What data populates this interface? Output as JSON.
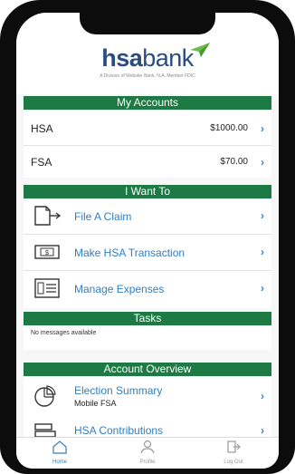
{
  "brand": {
    "logo_text_a": "hsa",
    "logo_text_b": "bank",
    "tagline": "A Division of Webster Bank, N.A. Member FDIC"
  },
  "sections": {
    "my_accounts": "My Accounts",
    "i_want_to": "I Want To",
    "tasks": "Tasks",
    "account_overview": "Account Overview"
  },
  "accounts": [
    {
      "name": "HSA",
      "amount": "$1000.00"
    },
    {
      "name": "FSA",
      "amount": "$70.00"
    }
  ],
  "want_to": [
    {
      "label": "File A Claim",
      "icon": "file-claim-icon"
    },
    {
      "label": "Make HSA Transaction",
      "icon": "money-transaction-icon"
    },
    {
      "label": "Manage Expenses",
      "icon": "manage-expenses-icon"
    }
  ],
  "tasks": {
    "message": "No messages available"
  },
  "overview": [
    {
      "label": "Election Summary",
      "sub": "Mobile FSA",
      "icon": "pie-chart-icon"
    },
    {
      "label": "HSA Contributions",
      "icon": "contributions-icon"
    }
  ],
  "tabs": [
    {
      "label": "Home",
      "icon": "home-icon",
      "active": true
    },
    {
      "label": "Profile",
      "icon": "profile-icon",
      "active": false
    },
    {
      "label": "Log Out",
      "icon": "logout-icon",
      "active": false
    }
  ],
  "chevron": "›",
  "colors": {
    "accent": "#1e7a44",
    "link": "#2f7fc4",
    "brand_blue": "#2b4c7e",
    "plane_green": "#6cc04a"
  }
}
